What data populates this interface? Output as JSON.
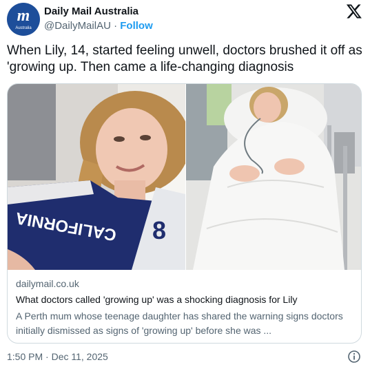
{
  "account": {
    "name": "Daily Mail Australia",
    "handle": "@DailyMailAU",
    "separator": "·",
    "follow_label": "Follow",
    "avatar_text": "m",
    "avatar_subtext": "Australia"
  },
  "tweet": {
    "text": "When Lily, 14, started feeling unwell, doctors brushed it off as 'growing up. Then came a life-changing diagnosis"
  },
  "card": {
    "photo_left_shirt_text": "CALIFORNIA",
    "photo_left_shirt_number": "8",
    "domain": "dailymail.co.uk",
    "title": "What doctors called 'growing up' was a shocking diagnosis for Lily",
    "description": "A Perth mum whose teenage daughter has shared the warning signs doctors initially dismissed as signs of 'growing up' before she was ..."
  },
  "footer": {
    "timestamp": "1:50 PM · Dec 11, 2025"
  },
  "icons": {
    "x_logo": "x-logo-icon",
    "info": "info-icon"
  },
  "colors": {
    "follow": "#1d9bf0",
    "secondary_text": "#536471",
    "avatar_bg": "#1d4e9a",
    "border": "#cfd9de"
  }
}
